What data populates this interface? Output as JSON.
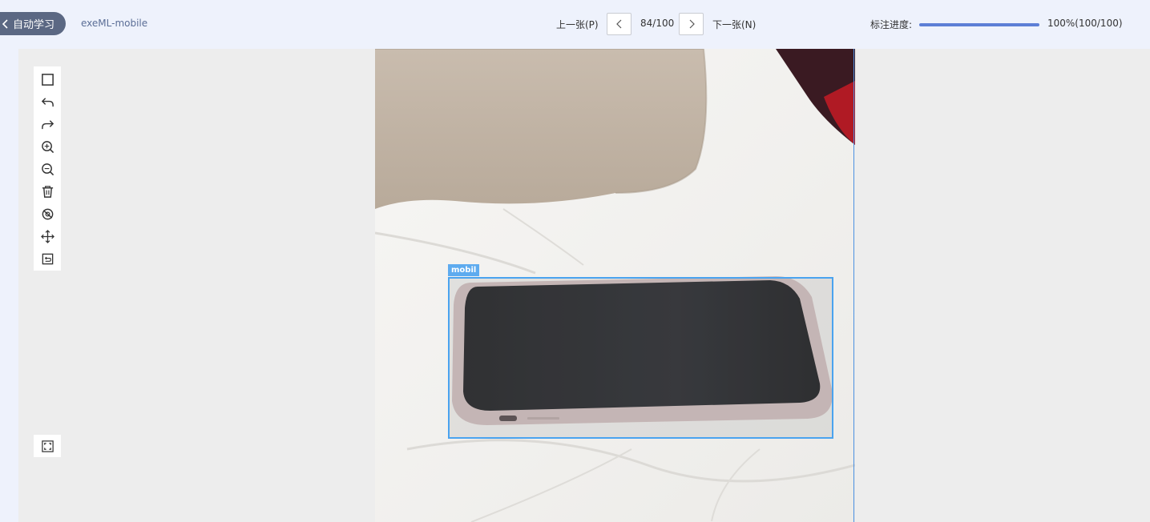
{
  "header": {
    "back_label": "自动学习",
    "project_name": "exeML-mobile",
    "prev_label": "上一张(P)",
    "page_count": "84/100",
    "next_label": "下一张(N)",
    "progress_label": "标注进度:",
    "progress_fraction": 1.0,
    "progress_value": "100%(100/100)"
  },
  "toolbar": {
    "tools": [
      "rectangle-icon",
      "undo-icon",
      "redo-icon",
      "zoom-in-icon",
      "zoom-out-icon",
      "delete-icon",
      "hide-icon",
      "move-icon",
      "reset-icon"
    ],
    "fit_tool": "fullscreen-icon"
  },
  "annotation": {
    "label": "mobil",
    "color": "#4aa3ef"
  },
  "colors": {
    "accent": "#5d7fd6",
    "back_button": "#5b6883",
    "header_bg": "#eef2fc",
    "canvas_bg": "#ededed"
  }
}
